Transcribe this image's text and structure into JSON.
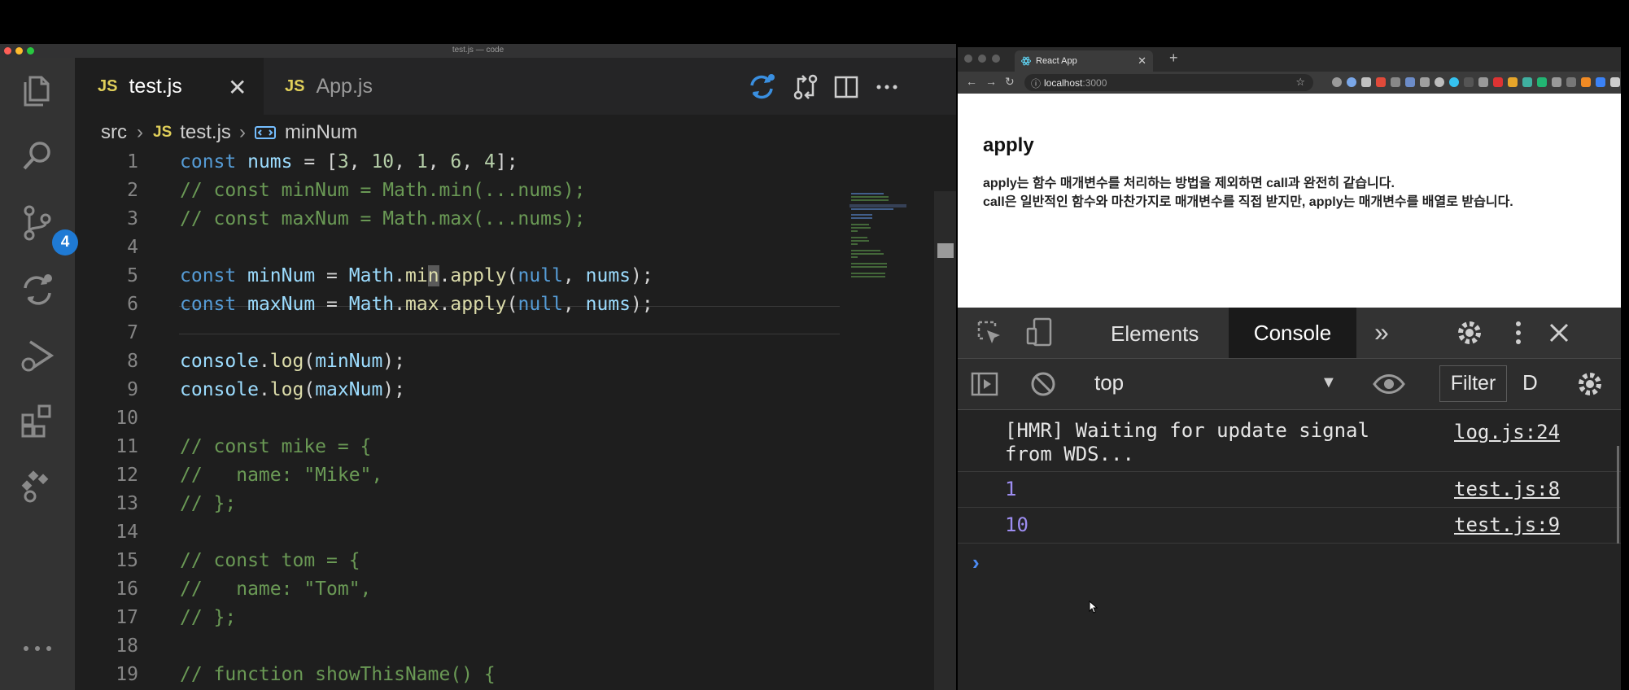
{
  "vscode": {
    "window_title": "test.js — code",
    "activity_badge": "4",
    "tabs": [
      {
        "label": "test.js",
        "lang": "JS",
        "active": true
      },
      {
        "label": "App.js",
        "lang": "JS",
        "active": false
      }
    ],
    "breadcrumb": {
      "folder": "src",
      "file_lang": "JS",
      "file": "test.js",
      "symbol": "minNum"
    },
    "lines": [
      {
        "n": "1",
        "text": "const nums = [3, 10, 1, 6, 4];"
      },
      {
        "n": "2",
        "text": "// const minNum = Math.min(...nums);"
      },
      {
        "n": "3",
        "text": "// const maxNum = Math.max(...nums);"
      },
      {
        "n": "4",
        "text": ""
      },
      {
        "n": "5",
        "text": "const minNum = Math.min.apply(null, nums);"
      },
      {
        "n": "6",
        "text": "const maxNum = Math.max.apply(null, nums);"
      },
      {
        "n": "7",
        "text": ""
      },
      {
        "n": "8",
        "text": "console.log(minNum);"
      },
      {
        "n": "9",
        "text": "console.log(maxNum);"
      },
      {
        "n": "10",
        "text": ""
      },
      {
        "n": "11",
        "text": "// const mike = {"
      },
      {
        "n": "12",
        "text": "//   name: \"Mike\","
      },
      {
        "n": "13",
        "text": "// };"
      },
      {
        "n": "14",
        "text": ""
      },
      {
        "n": "15",
        "text": "// const tom = {"
      },
      {
        "n": "16",
        "text": "//   name: \"Tom\","
      },
      {
        "n": "17",
        "text": "// };"
      },
      {
        "n": "18",
        "text": ""
      },
      {
        "n": "19",
        "text": "// function showThisName() {"
      }
    ]
  },
  "browser": {
    "tab_title": "React App",
    "new_tab": "+",
    "url_host": "localhost",
    "url_port": ":3000",
    "heading": "apply",
    "para1": "apply는 함수 매개변수를 처리하는 방법을 제외하면 call과 완전히 같습니다.",
    "para2": "call은 일반적인 함수와 마찬가지로 매개변수를 직접 받지만, apply는 매개변수를 배열로 받습니다."
  },
  "devtools": {
    "tabs": {
      "elements": "Elements",
      "console": "Console",
      "more": "»"
    },
    "context": "top",
    "filter": "Filter",
    "levels": "D",
    "messages": [
      {
        "text1": "[HMR] Waiting for update signal",
        "text2": "from WDS...",
        "source": "log.js:24"
      },
      {
        "text": "1",
        "source": "test.js:8"
      },
      {
        "text": "10",
        "source": "test.js:9"
      }
    ],
    "prompt": "›"
  },
  "colors": {
    "editor_bg": "#1e1e1e",
    "activity_bg": "#333333",
    "badge": "#1f7ad4",
    "keyword": "#569cd6",
    "comment": "#6a9955",
    "number_log": "#9d8df1"
  }
}
